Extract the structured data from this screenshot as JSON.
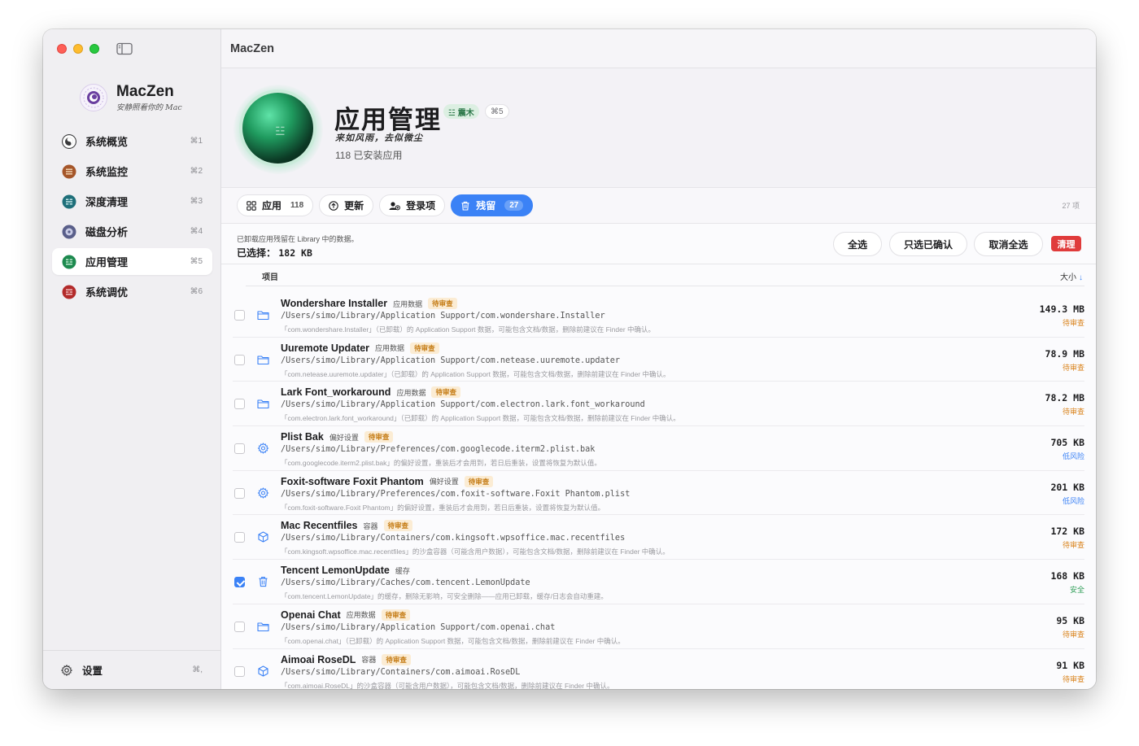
{
  "app": {
    "title": "MacZen",
    "brand_name": "MacZen",
    "brand_subtitle": "安静照看你的 Mac"
  },
  "sidebar": {
    "items": [
      {
        "label": "系统概览",
        "shortcut": "⌘1",
        "color": "#3a3a3c"
      },
      {
        "label": "系统监控",
        "shortcut": "⌘2",
        "color": "#a5562a"
      },
      {
        "label": "深度清理",
        "shortcut": "⌘3",
        "color": "#1f6f7a"
      },
      {
        "label": "磁盘分析",
        "shortcut": "⌘4",
        "color": "#5a5f8a"
      },
      {
        "label": "应用管理",
        "shortcut": "⌘5",
        "color": "#1e8a4f"
      },
      {
        "label": "系统调优",
        "shortcut": "⌘6",
        "color": "#b32b2b"
      }
    ],
    "settings_label": "设置",
    "settings_shortcut": "⌘,"
  },
  "hero": {
    "title": "应用管理",
    "badge": "☳ 震木",
    "shortcut": "⌘5",
    "motto": "来如风雨，去似微尘",
    "count_text": "118 已安装应用",
    "orb_glyph": "☳"
  },
  "tabs": [
    {
      "label": "应用",
      "count": "118",
      "icon": "grid-icon"
    },
    {
      "label": "更新",
      "count": "",
      "icon": "arrow-up-circle-icon"
    },
    {
      "label": "登录项",
      "count": "",
      "icon": "login-item-icon"
    },
    {
      "label": "残留",
      "count": "27",
      "icon": "trash-icon",
      "active": true
    }
  ],
  "total_items": "27 项",
  "toolbar": {
    "hint": "已卸载应用残留在 Library 中的数据。",
    "selected_label": "已选择：",
    "selected_value": "182 KB",
    "select_all": "全选",
    "select_confirmed": "只选已确认",
    "deselect_all": "取消全选",
    "clean": "清理"
  },
  "list": {
    "header_item": "项目",
    "header_size": "大小",
    "header_sort_arrow": "↓",
    "rows": [
      {
        "name": "Wondershare Installer",
        "category": "应用数据",
        "badge": "待审查",
        "icon": "folder-icon",
        "checked": false,
        "path": "/Users/simo/Library/Application Support/com.wondershare.Installer",
        "note": "「com.wondershare.Installer」（已卸载）的 Application Support 数据，可能包含文档/数据，删除前建议在 Finder 中确认。",
        "size": "149.3 MB",
        "status": "待审查",
        "status_color": "#d9821a"
      },
      {
        "name": "Uuremote Updater",
        "category": "应用数据",
        "badge": "待审查",
        "icon": "folder-icon",
        "checked": false,
        "path": "/Users/simo/Library/Application Support/com.netease.uuremote.updater",
        "note": "「com.netease.uuremote.updater」（已卸载）的 Application Support 数据，可能包含文档/数据，删除前建议在 Finder 中确认。",
        "size": "78.9 MB",
        "status": "待审查",
        "status_color": "#d9821a"
      },
      {
        "name": "Lark Font_workaround",
        "category": "应用数据",
        "badge": "待审查",
        "icon": "folder-icon",
        "checked": false,
        "path": "/Users/simo/Library/Application Support/com.electron.lark.font_workaround",
        "note": "「com.electron.lark.font_workaround」（已卸载）的 Application Support 数据，可能包含文档/数据，删除前建议在 Finder 中确认。",
        "size": "78.2 MB",
        "status": "待审查",
        "status_color": "#d9821a"
      },
      {
        "name": "Plist Bak",
        "category": "偏好设置",
        "badge": "待审查",
        "icon": "gear-icon",
        "checked": false,
        "path": "/Users/simo/Library/Preferences/com.googlecode.iterm2.plist.bak",
        "note": "「com.googlecode.iterm2.plist.bak」的偏好设置，重装后才会用到，若日后重装，设置将恢复为默认值。",
        "size": "705 KB",
        "status": "低风险",
        "status_color": "#3b82f6"
      },
      {
        "name": "Foxit-software Foxit Phantom",
        "category": "偏好设置",
        "badge": "待审查",
        "icon": "gear-icon",
        "checked": false,
        "path": "/Users/simo/Library/Preferences/com.foxit-software.Foxit Phantom.plist",
        "note": "「com.foxit-software.Foxit Phantom」的偏好设置，重装后才会用到，若日后重装，设置将恢复为默认值。",
        "size": "201 KB",
        "status": "低风险",
        "status_color": "#3b82f6"
      },
      {
        "name": "Mac Recentfiles",
        "category": "容器",
        "badge": "待审查",
        "icon": "cube-icon",
        "checked": false,
        "path": "/Users/simo/Library/Containers/com.kingsoft.wpsoffice.mac.recentfiles",
        "note": "「com.kingsoft.wpsoffice.mac.recentfiles」的沙盒容器（可能含用户数据），可能包含文档/数据，删除前建议在 Finder 中确认。",
        "size": "172 KB",
        "status": "待审查",
        "status_color": "#d9821a"
      },
      {
        "name": "Tencent LemonUpdate",
        "category": "缓存",
        "badge": "",
        "icon": "trash-icon",
        "checked": true,
        "path": "/Users/simo/Library/Caches/com.tencent.LemonUpdate",
        "note": "「com.tencent.LemonUpdate」的缓存，删除无影响，可安全删除——应用已卸载，缓存/日志会自动重建。",
        "size": "168 KB",
        "status": "安全",
        "status_color": "#2e9e57"
      },
      {
        "name": "Openai Chat",
        "category": "应用数据",
        "badge": "待审查",
        "icon": "folder-icon",
        "checked": false,
        "path": "/Users/simo/Library/Application Support/com.openai.chat",
        "note": "「com.openai.chat」（已卸载）的 Application Support 数据，可能包含文档/数据，删除前建议在 Finder 中确认。",
        "size": "95 KB",
        "status": "待审查",
        "status_color": "#d9821a"
      },
      {
        "name": "Aimoai RoseDL",
        "category": "容器",
        "badge": "待审查",
        "icon": "cube-icon",
        "checked": false,
        "path": "/Users/simo/Library/Containers/com.aimoai.RoseDL",
        "note": "「com.aimoai.RoseDL」的沙盒容器（可能含用户数据），可能包含文档/数据，删除前建议在 Finder 中确认。",
        "size": "91 KB",
        "status": "待审查",
        "status_color": "#d9821a"
      }
    ]
  }
}
